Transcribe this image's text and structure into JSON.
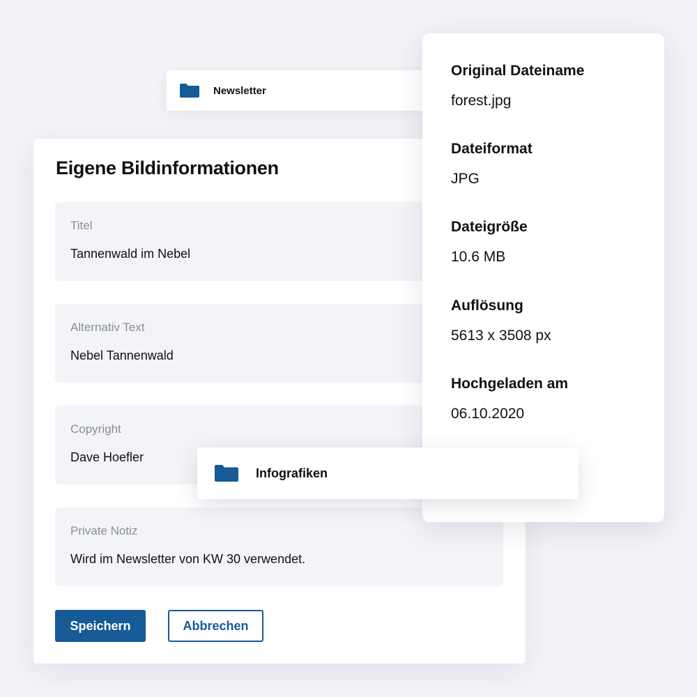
{
  "folders": {
    "newsletter": {
      "label": "Newsletter",
      "icon": "folder-icon"
    },
    "infografiken": {
      "label": "Infografiken",
      "icon": "folder-icon"
    }
  },
  "form": {
    "title": "Eigene Bildinformationen",
    "fields": [
      {
        "label": "Titel",
        "value": "Tannenwald im Nebel"
      },
      {
        "label": "Alternativ Text",
        "value": "Nebel Tannenwald"
      },
      {
        "label": "Copyright",
        "value": "Dave Hoefler"
      },
      {
        "label": "Private Notiz",
        "value": "Wird im Newsletter von KW 30 verwendet."
      }
    ],
    "save_label": "Speichern",
    "cancel_label": "Abbrechen"
  },
  "info": {
    "items": [
      {
        "label": "Original Dateiname",
        "value": "forest.jpg"
      },
      {
        "label": "Dateiformat",
        "value": "JPG"
      },
      {
        "label": "Dateigröße",
        "value": "10.6 MB"
      },
      {
        "label": "Auflösung",
        "value": "5613 x 3508 px"
      },
      {
        "label": "Hochgeladen am",
        "value": "06.10.2020"
      }
    ]
  },
  "colors": {
    "background": "#f2f3f7",
    "accent": "#165a96",
    "field_background": "#f3f4f8",
    "label_gray": "#8a8d96"
  }
}
